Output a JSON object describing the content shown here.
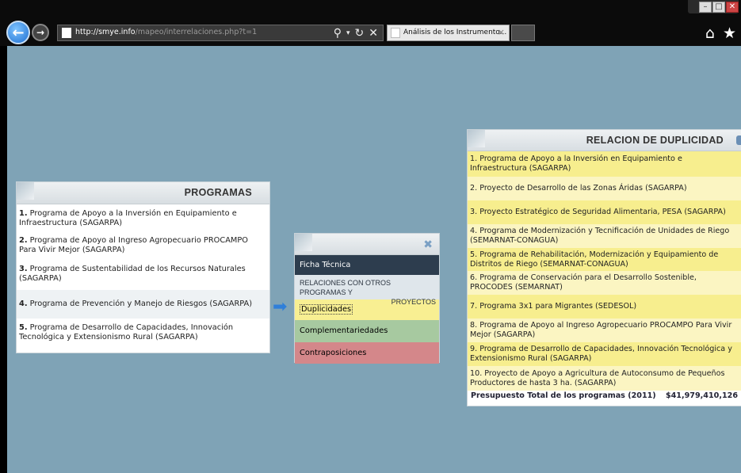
{
  "browser": {
    "url_host": "http://smye.info",
    "url_path": "/mapeo/interrelaciones.php?t=1",
    "tab_title": "Análisis de los Instrumento...",
    "tab_close": "×"
  },
  "programs_panel": {
    "title": "PROGRAMAS",
    "items": [
      {
        "num": "1.",
        "text": " Programa de Apoyo a la Inversión en Equipamiento e Infraestructura (SAGARPA)"
      },
      {
        "num": "2.",
        "text": " Programa de Apoyo al Ingreso Agropecuario PROCAMPO Para Vivir Mejor (SAGARPA)"
      },
      {
        "num": "3.",
        "text": " Programa de Sustentabilidad de los Recursos Naturales (SAGARPA)"
      },
      {
        "num": "4.",
        "text": " Programa de Prevención y Manejo de Riesgos (SAGARPA)"
      },
      {
        "num": "5.",
        "text": " Programa de Desarrollo de Capacidades, Innovación Tecnológica y Extensionismo Rural (SAGARPA)"
      }
    ]
  },
  "menu_panel": {
    "ficha": "Ficha Técnica",
    "relaciones_line1": "RELACIONES CON OTROS PROGRAMAS Y",
    "relaciones_line2": "PROYECTOS",
    "duplicidades": "Duplicidades",
    "complementariedades": "Complementariedades",
    "contraposiciones": "Contraposiciones"
  },
  "duplicidad_panel": {
    "title": "RELACION DE DUPLICIDAD",
    "items": [
      "1. Programa de Apoyo a la Inversión en Equipamiento e Infraestructura (SAGARPA)",
      "2. Proyecto de Desarrollo de las Zonas Áridas (SAGARPA)",
      "3. Proyecto Estratégico de Seguridad Alimentaria, PESA (SAGARPA)",
      "4. Programa de Modernización y Tecnificación de Unidades de Riego (SEMARNAT-CONAGUA)",
      "5. Programa de Rehabilitación, Modernización y Equipamiento de Distritos de Riego (SEMARNAT-CONAGUA)",
      "6. Programa de Conservación para el Desarrollo Sostenible, PROCODES (SEMARNAT)",
      "7. Programa 3x1 para Migrantes (SEDESOL)",
      "8. Programa de Apoyo al Ingreso Agropecuario PROCAMPO Para Vivir Mejor (SAGARPA)",
      "9. Programa de Desarrollo de Capacidades, Innovación Tecnológica y Extensionismo Rural (SAGARPA)",
      "10. Proyecto de Apoyo a Agricultura de Autoconsumo de Pequeños Productores de hasta 3 ha. (SAGARPA)"
    ],
    "total_label": "Presupuesto Total de los programas (2011)",
    "total_value": "$41,979,410,126"
  },
  "colors": {
    "background": "#7fa3b6",
    "duplicidades": "#f8ef92",
    "complementariedades": "#a7c9a0",
    "contraposiciones": "#d4878a",
    "ficha": "#2d3d4e"
  }
}
